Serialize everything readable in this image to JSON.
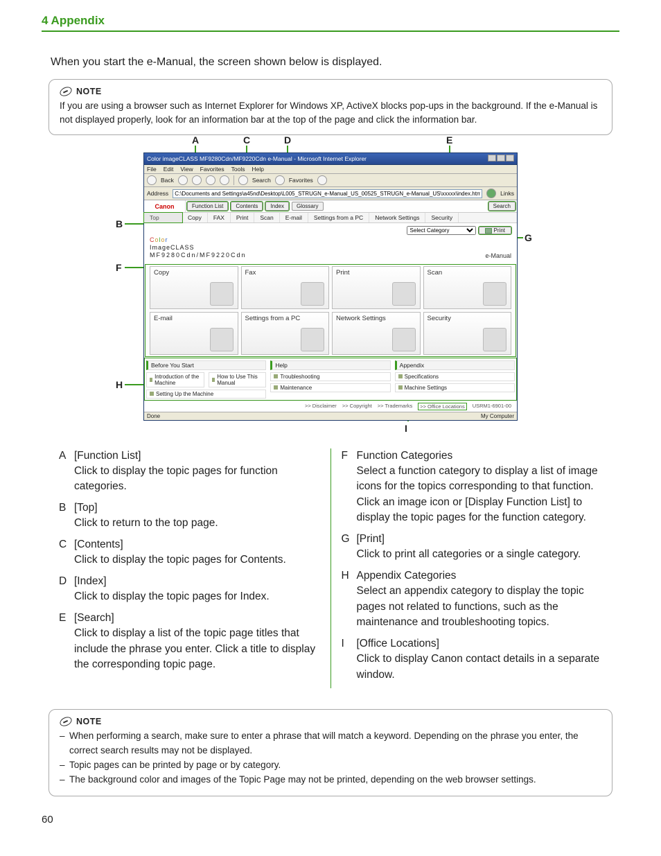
{
  "chapter": "4 Appendix",
  "intro": "When you start the e-Manual, the screen shown below is displayed.",
  "note1": {
    "label": "NOTE",
    "text": "If you are using a browser such as Internet Explorer for Windows XP, ActiveX blocks pop-ups in the background. If the e-Manual is not displayed properly, look for an information bar at the top of the page and click the information bar."
  },
  "callouts": {
    "A": "A",
    "B": "B",
    "C": "C",
    "D": "D",
    "E": "E",
    "F": "F",
    "G": "G",
    "H": "H",
    "I": "I"
  },
  "browser": {
    "title": "Color imageCLASS MF9280Cdn/MF9220Cdn e-Manual - Microsoft Internet Explorer",
    "menu": [
      "File",
      "Edit",
      "View",
      "Favorites",
      "Tools",
      "Help"
    ],
    "toolbar": {
      "back": "Back",
      "search": "Search",
      "favorites": "Favorites"
    },
    "address_label": "Address",
    "address": "C:\\Documents and Settings\\a45nd\\Desktop\\L005_STRUGN_e-Manual_US_00525_STRUGN_e-Manual_US\\xxxxx\\index.html",
    "links": "Links",
    "brand": "Canon",
    "nav": {
      "func": "Function List",
      "contents": "Contents",
      "index": "Index",
      "glossary": "Glossary",
      "search": "Search"
    },
    "tabs": [
      "Top",
      "Copy",
      "FAX",
      "Print",
      "Scan",
      "E-mail",
      "Settings from a PC",
      "Network Settings",
      "Security"
    ],
    "select_category": "Select Category",
    "print_btn": "Print",
    "product_line1": "Color",
    "product_line2": "ImageCLASS",
    "product_line3": "MF9280Cdn/MF9220Cdn",
    "emanual": "e-Manual",
    "tiles": [
      "Copy",
      "Fax",
      "Print",
      "Scan",
      "E-mail",
      "Settings from a PC",
      "Network Settings",
      "Security"
    ],
    "bottom_headers": [
      "Before You Start",
      "Help",
      "Appendix"
    ],
    "bottom_cells": [
      "Introduction of the Machine",
      "How to Use This Manual",
      "",
      "Troubleshooting",
      "",
      "Specifications",
      "Setting Up the Machine",
      "",
      "",
      "Maintenance",
      "",
      "Machine Settings"
    ],
    "bottom_cells_grid": {
      "r1c1": "Introduction of the Machine",
      "r1c2": "Troubleshooting",
      "r1c3": "Specifications",
      "r1b1": "How to Use This Manual",
      "r1b2": "",
      "r1b3": "",
      "r2c1": "Setting Up the Machine",
      "r2c2": "Maintenance",
      "r2c3": "Machine Settings"
    },
    "footer_links": [
      ">> Disclaimer",
      ">> Copyright",
      ">> Trademarks",
      ">> Office Locations"
    ],
    "footer_code": "USRM1-6901-00",
    "status_done": "Done",
    "status_mycomp": "My Computer"
  },
  "defs_left": [
    {
      "l": "A",
      "term": "[Function List]",
      "desc": "Click to display the topic pages for function categories."
    },
    {
      "l": "B",
      "term": "[Top]",
      "desc": "Click to return to the top page."
    },
    {
      "l": "C",
      "term": "[Contents]",
      "desc": "Click to display the topic pages for Contents."
    },
    {
      "l": "D",
      "term": "[Index]",
      "desc": "Click to display the topic pages for Index."
    },
    {
      "l": "E",
      "term": "[Search]",
      "desc": "Click to display a list of the topic page titles that include the phrase you enter. Click a title to display the corresponding topic page."
    }
  ],
  "defs_right": [
    {
      "l": "F",
      "term": "Function Categories",
      "desc": "Select a function category to display a list of image icons for the topics corresponding to that function. Click an image icon or [Display Function List] to display the topic pages for the function category."
    },
    {
      "l": "G",
      "term": "[Print]",
      "desc": "Click to print all categories or a single category."
    },
    {
      "l": "H",
      "term": "Appendix Categories",
      "desc": "Select an appendix category to display the topic pages not related to functions, such as the maintenance and troubleshooting topics."
    },
    {
      "l": "I",
      "term": "[Office Locations]",
      "desc": "Click to display Canon contact details in a separate window."
    }
  ],
  "note2": {
    "label": "NOTE",
    "items": [
      "When performing a search, make sure to enter a phrase that will match a keyword. Depending on the phrase you enter, the correct search results may not be displayed.",
      "Topic pages can be printed by page or by category.",
      "The background color and images of the Topic Page may not be printed, depending on the web browser settings."
    ]
  },
  "page_number": "60"
}
